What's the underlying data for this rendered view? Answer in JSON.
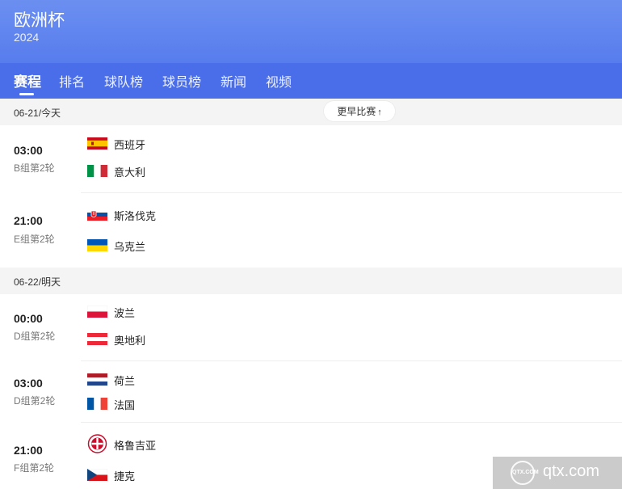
{
  "header": {
    "title": "欧洲杯",
    "year": "2024"
  },
  "tabs": [
    "赛程",
    "排名",
    "球队榜",
    "球员榜",
    "新闻",
    "视频"
  ],
  "more_button": {
    "label": "更早比赛",
    "icon": "chevron-up-icon"
  },
  "days": [
    {
      "date": "06-21/今天",
      "matches": [
        {
          "time": "03:00",
          "round": "B组第2轮",
          "home": {
            "name": "西班牙",
            "flag": "spain-flag-icon"
          },
          "away": {
            "name": "意大利",
            "flag": "italy-flag-icon"
          }
        },
        {
          "time": "21:00",
          "round": "E组第2轮",
          "home": {
            "name": "斯洛伐克",
            "flag": "slovakia-flag-icon"
          },
          "away": {
            "name": "乌克兰",
            "flag": "ukraine-flag-icon"
          }
        }
      ]
    },
    {
      "date": "06-22/明天",
      "matches": [
        {
          "time": "00:00",
          "round": "D组第2轮",
          "home": {
            "name": "波兰",
            "flag": "poland-flag-icon"
          },
          "away": {
            "name": "奥地利",
            "flag": "austria-flag-icon"
          }
        },
        {
          "time": "03:00",
          "round": "D组第2轮",
          "home": {
            "name": "荷兰",
            "flag": "netherlands-flag-icon"
          },
          "away": {
            "name": "法国",
            "flag": "france-flag-icon"
          }
        },
        {
          "time": "21:00",
          "round": "F组第2轮",
          "home": {
            "name": "格鲁吉亚",
            "flag": "georgia-federation-logo-icon"
          },
          "away": {
            "name": "捷克",
            "flag": "czech-flag-icon"
          }
        }
      ]
    }
  ],
  "watermark": {
    "logo_text": "QTX.COM",
    "text": "qtx.com"
  },
  "colors": {
    "header_top": "#6b8ff0",
    "tab_bar": "#4a6ee9",
    "date_bar": "#f4f4f4"
  }
}
